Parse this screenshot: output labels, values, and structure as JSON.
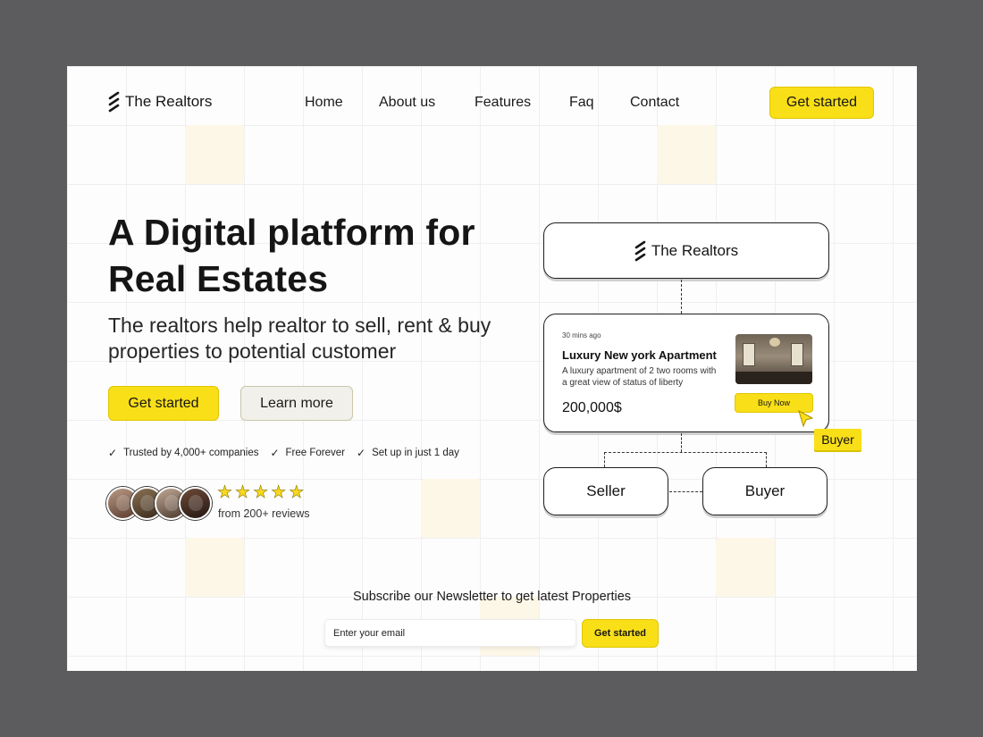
{
  "brand": {
    "name": "The Realtors",
    "accent": "#f9df18"
  },
  "nav": {
    "items": [
      "Home",
      "About us",
      "Features",
      "Faq",
      "Contact"
    ],
    "cta_label": "Get started"
  },
  "hero": {
    "title_line1": "A Digital platform for",
    "title_line2": "Real Estates",
    "subtitle": "The realtors help realtor to sell, rent & buy properties to potential customer",
    "primary_cta": "Get started",
    "secondary_cta": "Learn more",
    "checks": [
      "Trusted by 4,000+ companies",
      "Free Forever",
      "Set up in just 1 day"
    ],
    "rating_stars": 5,
    "reviews_text": "from 200+ reviews"
  },
  "diagram": {
    "top_node": "The Realtors",
    "listing": {
      "time": "30 mins ago",
      "title": "Luxury New york Apartment",
      "description": "A luxury apartment of 2 two rooms with a great view of status of liberty",
      "price": "200,000$",
      "buy_label": "Buy Now"
    },
    "cursor_tag": "Buyer",
    "seller_node": "Seller",
    "buyer_node": "Buyer"
  },
  "newsletter": {
    "title": "Subscribe our Newsletter to get latest Properties",
    "placeholder": "Enter your email",
    "button_label": "Get started"
  }
}
